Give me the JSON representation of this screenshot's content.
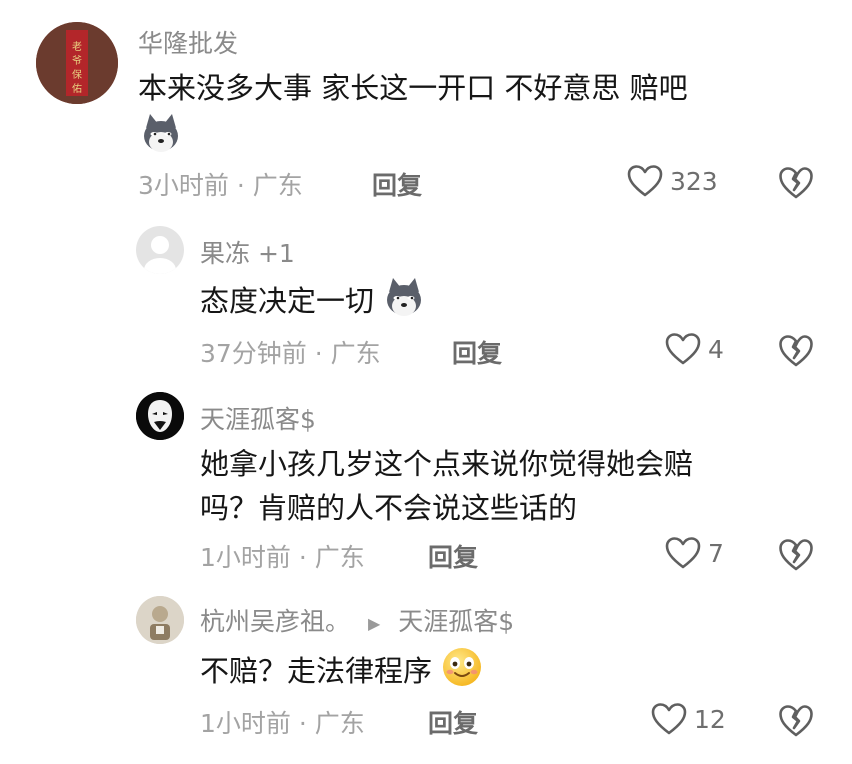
{
  "comments": [
    {
      "username": "华隆批发",
      "text": "本来没多大事 家长这一开口 不好意思 赔吧",
      "time_location": "3小时前 · 广东",
      "reply_label": "回复",
      "likes": "323",
      "emoji": "dog-emoji"
    },
    {
      "username": "果冻 +1",
      "text": "态度决定一切",
      "time_location": "37分钟前 · 广东",
      "reply_label": "回复",
      "likes": "4",
      "emoji": "dog-emoji"
    },
    {
      "username": "天涯孤客$",
      "text_line1": "她拿小孩几岁这个点来说你觉得她会赔",
      "text_line2": "吗？肯赔的人不会说这些话的",
      "time_location": "1小时前 · 广东",
      "reply_label": "回复",
      "likes": "7"
    },
    {
      "username": "杭州吴彦祖。",
      "reply_to": "天涯孤客$",
      "text": "不赔？走法律程序",
      "time_location": "1小时前 · 广东",
      "reply_label": "回复",
      "likes": "12",
      "emoji": "smile-emoji"
    }
  ],
  "colors": {
    "username": "#8a8a8a",
    "text": "#161616",
    "meta": "#a3a3a3"
  }
}
